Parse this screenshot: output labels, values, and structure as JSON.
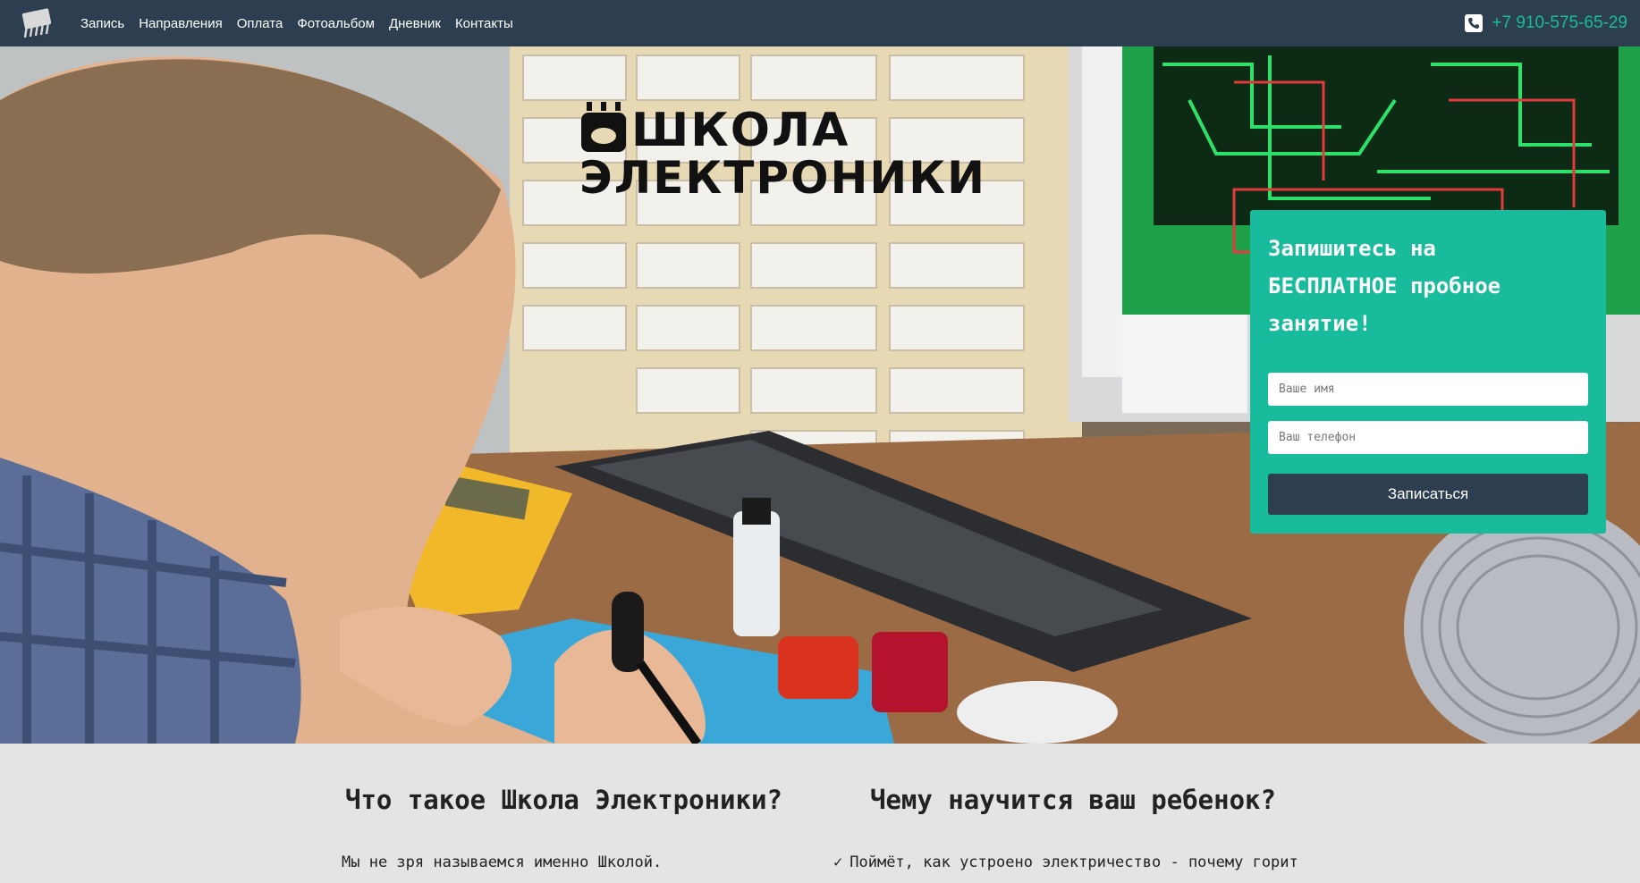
{
  "nav": {
    "items": [
      {
        "label": "Запись"
      },
      {
        "label": "Направления"
      },
      {
        "label": "Оплата"
      },
      {
        "label": "Фотоальбом"
      },
      {
        "label": "Дневник"
      },
      {
        "label": "Контакты"
      }
    ],
    "phone": "+7 910-575-65-29",
    "logo_icon": "chip-icon",
    "phone_icon": "phone-icon"
  },
  "hero": {
    "logo_line1": "ШКОЛА",
    "logo_line2": "ЭЛЕКТРОНИКИ"
  },
  "signup": {
    "title_line1": "Запишитесь на",
    "title_line2": "БЕСПЛАТНОЕ пробное",
    "title_line3": "занятие!",
    "name_placeholder": "Ваше имя",
    "phone_placeholder": "Ваш телефон",
    "button_label": "Записаться"
  },
  "about": {
    "left_heading": "Что такое Школа Электроники?",
    "right_heading": "Чему научится ваш ребенок?",
    "left_text": "Мы не зря называемся именно Школой.",
    "right_check": "✓",
    "right_text": "Поймёт, как устроено электричество - почему горит"
  },
  "colors": {
    "navbar": "#2c3e50",
    "accent": "#18bc9c",
    "button": "#2c3e50",
    "section_bg": "#e4e4e4"
  }
}
